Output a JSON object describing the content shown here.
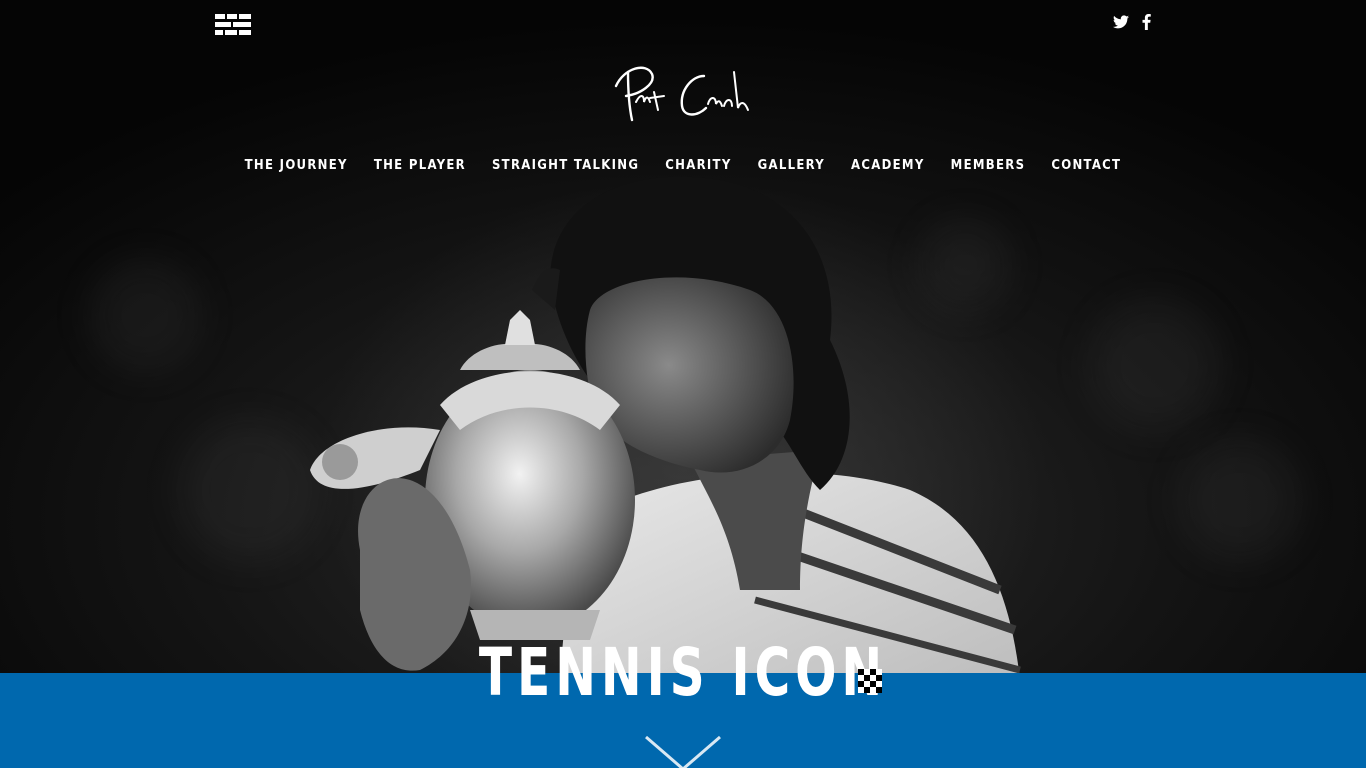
{
  "site": {
    "logo_alt": "Pat Cash signature",
    "icons": {
      "menu": "grid-menu-icon",
      "twitter": "twitter-icon",
      "facebook": "facebook-icon",
      "scroll": "chevron-down-icon"
    }
  },
  "nav": {
    "items": [
      {
        "label": "THE JOURNEY"
      },
      {
        "label": "THE PLAYER"
      },
      {
        "label": "STRAIGHT TALKING"
      },
      {
        "label": "CHARITY"
      },
      {
        "label": "GALLERY"
      },
      {
        "label": "ACADEMY"
      },
      {
        "label": "MEMBERS"
      },
      {
        "label": "CONTACT"
      }
    ]
  },
  "hero": {
    "headline": "TENNIS ICON"
  },
  "colors": {
    "band": "#0068ae",
    "background": "#000000",
    "text": "#ffffff"
  }
}
